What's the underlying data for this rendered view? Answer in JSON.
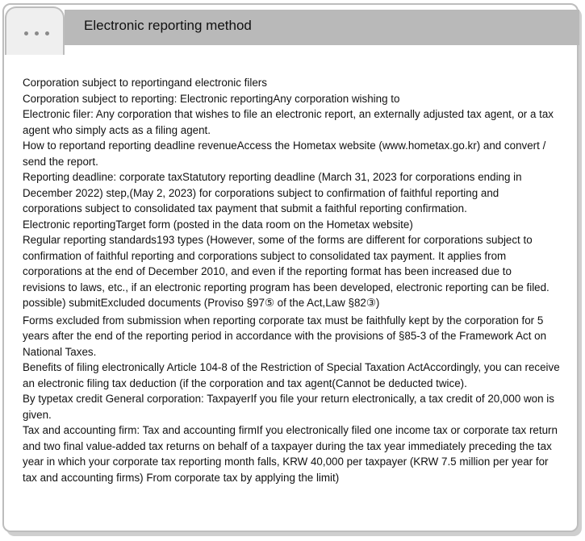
{
  "window": {
    "title": "Electronic reporting method"
  },
  "lines": [
    "Corporation subject to reportingand electronic filers",
    "Corporation subject to reporting: Electronic reportingAny corporation wishing to",
    "Electronic filer: Any corporation that wishes to file an electronic report, an externally adjusted tax agent, or a tax",
    "agent who simply acts as a filing agent.",
    "How to reportand reporting deadline revenueAccess the Hometax website (www.hometax.go.kr) and convert /",
    "send the report.",
    "Reporting deadline: corporate taxStatutory reporting deadline (March 31, 2023 for corporations ending in",
    "December 2022) step,(May 2, 2023) for corporations subject to confirmation of faithful reporting and",
    "corporations subject to consolidated tax payment that submit a faithful reporting confirmation.",
    "Electronic reportingTarget form (posted in the data room on the Hometax website)",
    "Regular reporting standards193 types (However, some of the forms are different for corporations subject to",
    "confirmation of faithful reporting and corporations subject to consolidated tax payment. It applies from",
    "corporations at the end of December 2010, and even if the reporting format has been increased due to",
    "revisions to laws, etc., if an electronic reporting program has been developed, electronic reporting can be filed.",
    "possible) submitExcluded documents (Proviso §97⑤ of the Act,Law §82③)",
    "Forms excluded from submission when reporting corporate tax must be faithfully kept by the corporation for 5",
    "years after the end of the reporting period in accordance with the provisions of §85-3 of the Framework Act on",
    "National Taxes.",
    "Benefits of filing electronically Article 104-8 of the Restriction of Special Taxation ActAccordingly, you can receive",
    "an electronic filing tax deduction (if the corporation and tax agent(Cannot be deducted twice).",
    "By typetax credit General corporation: TaxpayerIf you file your return electronically, a tax credit of 20,000 won is",
    "given.",
    "Tax and accounting firm: Tax and accounting firmIf you electronically filed one income tax or corporate tax return",
    "and two final value-added tax returns on behalf of a taxpayer during the tax year immediately preceding the tax",
    "year in which your corporate tax reporting month falls, KRW 40,000 per taxpayer (KRW 7.5 million per year for",
    "tax and accounting firms) From corporate tax by applying the limit)"
  ]
}
